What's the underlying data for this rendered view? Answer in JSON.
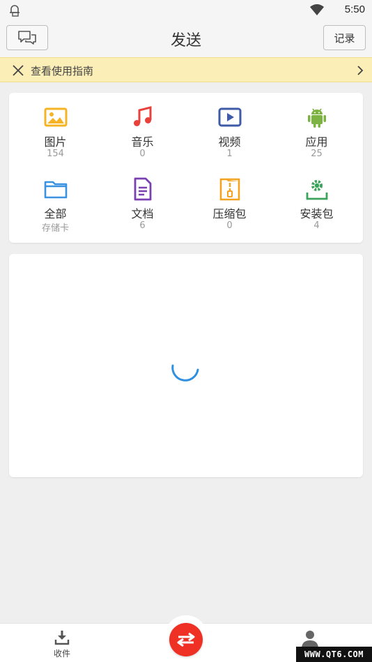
{
  "status_bar": {
    "time": "5:50"
  },
  "header": {
    "title": "发送",
    "record_label": "记录"
  },
  "guide_banner": {
    "text": "查看使用指南"
  },
  "categories": [
    {
      "label": "图片",
      "count": "154",
      "icon": "image-icon",
      "color": "#f6b324"
    },
    {
      "label": "音乐",
      "count": "0",
      "icon": "music-icon",
      "color": "#e8413c"
    },
    {
      "label": "视频",
      "count": "1",
      "icon": "video-icon",
      "color": "#3e5aa8"
    },
    {
      "label": "应用",
      "count": "25",
      "icon": "android-icon",
      "color": "#7cb342"
    },
    {
      "label": "全部",
      "count": "存储卡",
      "icon": "folder-icon",
      "color": "#3a92e0"
    },
    {
      "label": "文档",
      "count": "6",
      "icon": "document-icon",
      "color": "#7a3fb0"
    },
    {
      "label": "压缩包",
      "count": "0",
      "icon": "zip-icon",
      "color": "#f2a31f"
    },
    {
      "label": "安装包",
      "count": "4",
      "icon": "install-package-icon",
      "color": "#3ba35b"
    }
  ],
  "bottom_bar": {
    "receive_label": "收件"
  },
  "watermark": "WWW.QT6.COM",
  "colors": {
    "accent_red": "#ee3025",
    "spinner_blue": "#2f8fe0",
    "banner_yellow": "#fbeeb6"
  }
}
